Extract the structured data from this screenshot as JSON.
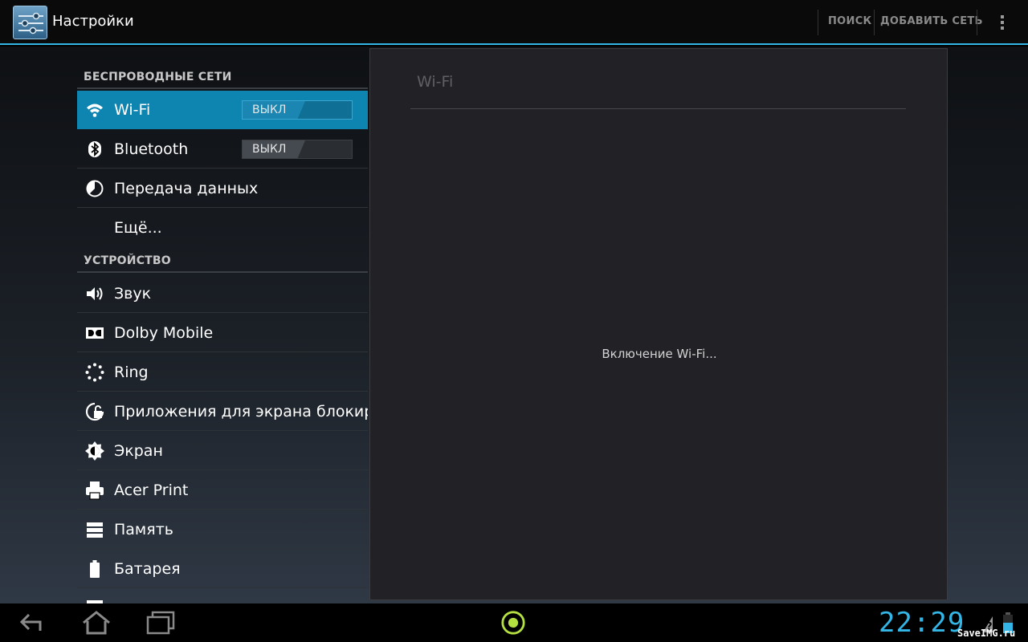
{
  "actionbar": {
    "title": "Настройки",
    "search_label": "ПОИСК",
    "add_network_label": "ДОБАВИТЬ СЕТЬ",
    "app_icon": "settings-sliders-icon",
    "overflow_icon": "overflow-menu-icon",
    "accent": "#33b5e5"
  },
  "sidebar": {
    "wireless_header": "БЕСПРОВОДНЫЕ СЕТИ",
    "device_header": "УСТРОЙСТВО",
    "items": [
      {
        "label": "Wi-Fi",
        "icon": "wifi-icon",
        "toggle": "ВЫКЛ",
        "selected": true
      },
      {
        "label": "Bluetooth",
        "icon": "bluetooth-icon",
        "toggle": "ВЫКЛ"
      },
      {
        "label": "Передача данных",
        "icon": "data-usage-icon"
      },
      {
        "label": "Ещё...",
        "icon": ""
      },
      {
        "label": "Звук",
        "icon": "speaker-icon"
      },
      {
        "label": "Dolby Mobile",
        "icon": "dolby-icon"
      },
      {
        "label": "Ring",
        "icon": "ring-icon"
      },
      {
        "label": "Приложения для экрана блокировки",
        "icon": "lock-screen-apps-icon"
      },
      {
        "label": "Экран",
        "icon": "brightness-icon"
      },
      {
        "label": "Acer Print",
        "icon": "printer-icon"
      },
      {
        "label": "Память",
        "icon": "storage-icon"
      },
      {
        "label": "Батарея",
        "icon": "battery-icon"
      }
    ]
  },
  "panel": {
    "title": "Wi-Fi",
    "status": "Включение Wi-Fi..."
  },
  "navbar": {
    "back_icon": "back-icon",
    "home_icon": "home-icon",
    "recents_icon": "recent-apps-icon",
    "ring_icon": "ring-launcher-icon",
    "clock": "22:29",
    "wifi_status_icon": "wifi-unknown-icon",
    "battery_status_icon": "battery-status-icon"
  },
  "watermark": "SaveIMG.ru"
}
